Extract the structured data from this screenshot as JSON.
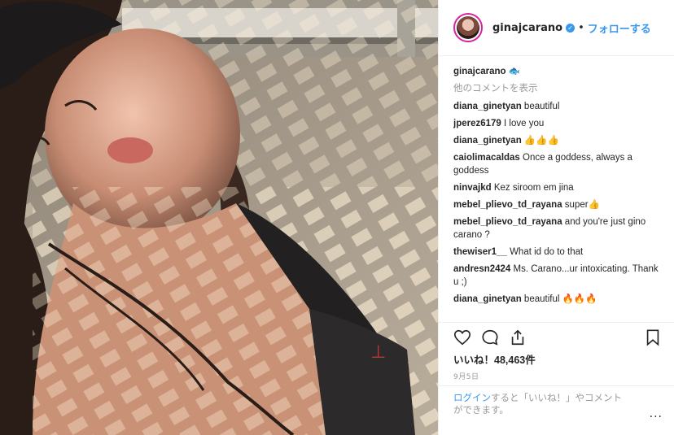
{
  "header": {
    "username": "ginajcarano",
    "separator": "•",
    "follow_label": "フォローする",
    "verified_mark": "✓"
  },
  "caption": {
    "username": "ginajcarano",
    "text": "🐟"
  },
  "load_more": "他のコメントを表示",
  "comments": [
    {
      "user": "diana_ginetyan",
      "text": "beautiful"
    },
    {
      "user": "jperez6179",
      "text": "I love you"
    },
    {
      "user": "diana_ginetyan",
      "text": "👍👍👍"
    },
    {
      "user": "caiolimacaldas",
      "text": "Once a goddess, always a goddess"
    },
    {
      "user": "ninvajkd",
      "text": "Kez siroom em jina"
    },
    {
      "user": "mebel_plievo_td_rayana",
      "text": "super👍"
    },
    {
      "user": "mebel_plievo_td_rayana",
      "text": "and you're just gino carano ?"
    },
    {
      "user": "thewiser1__",
      "text": "What id do to that"
    },
    {
      "user": "andresn2424",
      "text": "Ms. Carano...ur intoxicating. Thank u ;)"
    },
    {
      "user": "diana_ginetyan",
      "text": "beautiful 🔥🔥🔥"
    }
  ],
  "icons": {
    "like": "heart-icon",
    "comment": "comment-bubble-icon",
    "share": "share-icon",
    "save": "bookmark-icon"
  },
  "likes_label": "いいね！48,463件",
  "date": "9月5日",
  "login": {
    "link": "ログイン",
    "text": "すると「いいね！」やコメントができます。"
  },
  "options_label": "···",
  "colors": {
    "link": "#3897f0",
    "text": "#262626",
    "muted": "#999999",
    "ring": "#d6249f"
  }
}
